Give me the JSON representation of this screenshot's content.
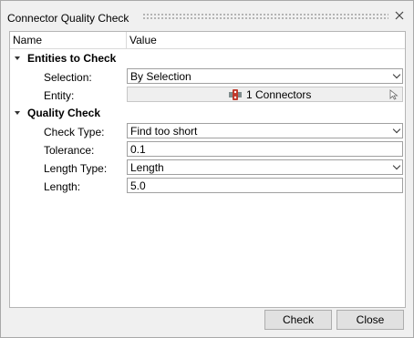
{
  "window": {
    "title": "Connector Quality Check"
  },
  "table": {
    "col_name": "Name",
    "col_value": "Value"
  },
  "groups": {
    "entities": {
      "label": "Entities to Check",
      "selection_label": "Selection:",
      "selection_value": "By Selection",
      "entity_label": "Entity:",
      "entity_value": "1 Connectors"
    },
    "quality": {
      "label": "Quality Check",
      "check_type_label": "Check Type:",
      "check_type_value": "Find too short",
      "tolerance_label": "Tolerance:",
      "tolerance_value": "0.1",
      "length_type_label": "Length Type:",
      "length_type_value": "Length",
      "length_label": "Length:",
      "length_value": "5.0"
    }
  },
  "buttons": {
    "check": "Check",
    "close": "Close"
  },
  "icons": {
    "connector": "connector-icon",
    "cursor": "cursor-arrow-icon",
    "close": "close-icon"
  },
  "colors": {
    "connector_icon": "#c0392b"
  }
}
